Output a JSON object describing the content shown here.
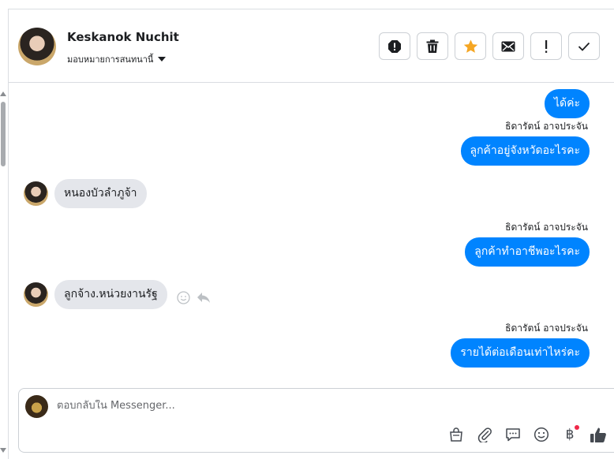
{
  "header": {
    "contact_name": "Keskanok Nuchit",
    "assign_label": "มอบหมายการสนทนานี้"
  },
  "actions": {
    "report": "report-icon",
    "delete": "trash-icon",
    "star": "star-icon",
    "mark_unread": "envelope-icon",
    "important": "exclamation-icon",
    "done": "check-icon",
    "star_color": "#f5a623"
  },
  "messages": [
    {
      "dir": "out",
      "text": "ได้ค่ะ"
    },
    {
      "dir": "out",
      "sender": "ธิดารัตน์ อาจประจัน",
      "text": "ลูกค้าอยู่จังหวัดอะไรคะ"
    },
    {
      "dir": "in",
      "text": "หนองบัวลำภูจ้า"
    },
    {
      "dir": "out",
      "sender": "ธิดารัตน์ อาจประจัน",
      "text": "ลูกค้าทำอาชีพอะไรคะ"
    },
    {
      "dir": "in",
      "text": "ลูกจ้าง.หน่วยงานรัฐ"
    },
    {
      "dir": "out",
      "sender": "ธิดารัตน์ อาจประจัน",
      "text": "รายได้ต่อเดือนเท่าไหร่คะ"
    }
  ],
  "composer": {
    "placeholder": "ตอบกลับใน Messenger...",
    "tools": [
      "bag-icon",
      "paperclip-icon",
      "saved-reply-icon",
      "emoji-icon",
      "payment-icon",
      "like-icon"
    ],
    "currency_symbol": "฿"
  },
  "colors": {
    "outgoing_bubble": "#0084ff",
    "incoming_bubble": "#e4e6eb",
    "notification_dot": "#f02849"
  }
}
